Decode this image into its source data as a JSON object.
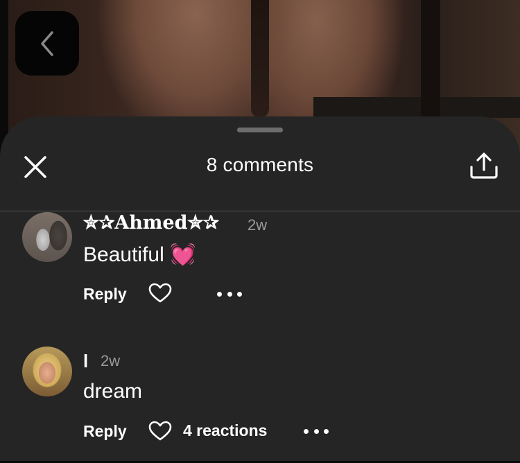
{
  "header": {
    "back_icon": "chevron-left-icon"
  },
  "sheet": {
    "title": "8 comments",
    "close_icon": "close-icon",
    "share_icon": "share-upload-icon"
  },
  "comments": [
    {
      "username": "✮✰Ahmed✮✰",
      "time": "2w",
      "text": "Beautiful",
      "emoji": "💓",
      "reply_label": "Reply",
      "reactions": ""
    },
    {
      "username": "l",
      "time": "2w",
      "text": "dream",
      "reply_label": "Reply",
      "reactions": "4 reactions"
    }
  ],
  "colors": {
    "sheet_bg": "#252525",
    "muted_text": "#9a9a9a",
    "divider": "#555555"
  }
}
